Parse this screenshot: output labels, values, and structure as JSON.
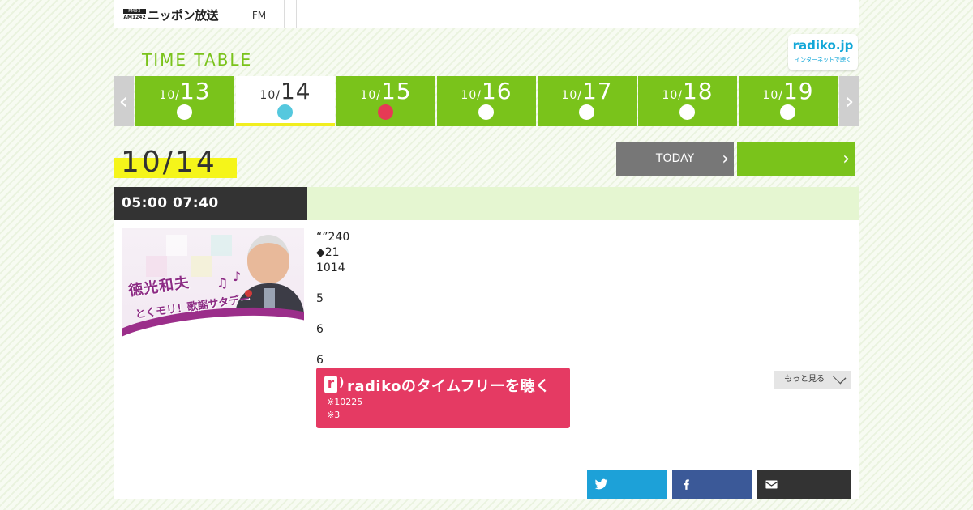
{
  "header": {
    "logo_badge_top": "FM93",
    "logo_badge_bottom": "AM1242",
    "logo_text": "ニッポン放送",
    "nav_fm": "FM"
  },
  "timetable_title": "TIME TABLE",
  "radiko_banner": {
    "main": "radiko.jp",
    "sub": "インターネットで聴く"
  },
  "day_tabs": [
    {
      "month": "10/",
      "day": "13",
      "dot_color": "#ffffff"
    },
    {
      "month": "10/",
      "day": "14",
      "dot_color": "#55c8de"
    },
    {
      "month": "10/",
      "day": "15",
      "dot_color": "#e63a55"
    },
    {
      "month": "10/",
      "day": "16",
      "dot_color": "#ffffff"
    },
    {
      "month": "10/",
      "day": "17",
      "dot_color": "#ffffff"
    },
    {
      "month": "10/",
      "day": "18",
      "dot_color": "#ffffff"
    },
    {
      "month": "10/",
      "day": "19",
      "dot_color": "#ffffff"
    }
  ],
  "selected_date": "10/14",
  "today_button": "TODAY",
  "program": {
    "time": "05:00  07:40",
    "thumbnail_text_1": "徳光和夫",
    "thumbnail_text_2": "とくモリ！歌謡サタデー",
    "description": "“”240\n◆21\n1014\n\n5\n\n6\n\n6"
  },
  "radiko_button": {
    "main": "radikoのタイムフリーを聴く",
    "note1": "※10225",
    "note2": "※3"
  },
  "more_button": "もっと見る",
  "share": {
    "twitter": "twitter-icon",
    "facebook": "facebook-icon",
    "mail": "mail-icon"
  },
  "colors": {
    "green": "#7ac31b",
    "radiko_pink": "#e53a63",
    "radiko_blue": "#12a7d8",
    "highlight_yellow": "#f5f51a",
    "twitter": "#1da1d8",
    "facebook": "#3b5998"
  }
}
